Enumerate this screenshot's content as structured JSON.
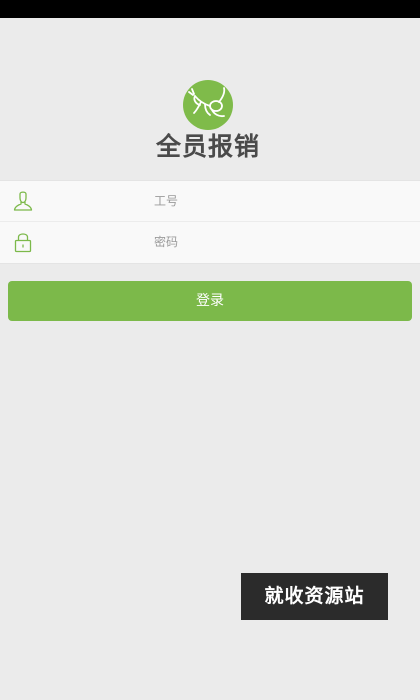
{
  "app": {
    "title": "全员报销",
    "logo_icon": "mantis-logo-icon",
    "brand_color": "#7cb94a"
  },
  "form": {
    "employee_id": {
      "icon": "user-icon",
      "placeholder": "工号",
      "value": ""
    },
    "password": {
      "icon": "lock-icon",
      "placeholder": "密码",
      "value": ""
    }
  },
  "actions": {
    "login_label": "登录"
  },
  "watermark": {
    "text": "就收资源站"
  }
}
